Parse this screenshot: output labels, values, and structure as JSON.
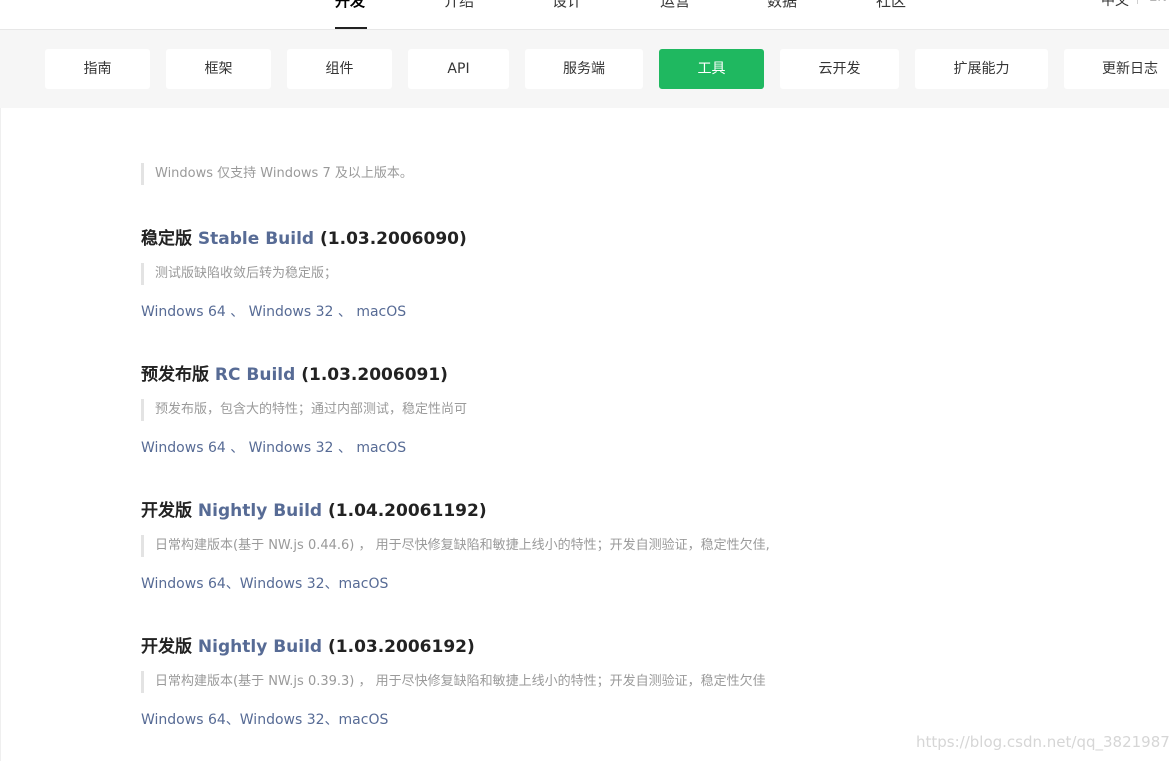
{
  "topnav": {
    "items": [
      {
        "label": "开发",
        "active": true
      },
      {
        "label": "介绍",
        "active": false
      },
      {
        "label": "设计",
        "active": false
      },
      {
        "label": "运营",
        "active": false
      },
      {
        "label": "数据",
        "active": false
      },
      {
        "label": "社区",
        "active": false
      }
    ],
    "lang_zh": "中文",
    "lang_en": "EN"
  },
  "tabs": [
    {
      "label": "指南",
      "active": false
    },
    {
      "label": "框架",
      "active": false
    },
    {
      "label": "组件",
      "active": false
    },
    {
      "label": "API",
      "active": false
    },
    {
      "label": "服务端",
      "active": false
    },
    {
      "label": "工具",
      "active": true
    },
    {
      "label": "云开发",
      "active": false
    },
    {
      "label": "扩展能力",
      "active": false
    },
    {
      "label": "更新日志",
      "active": false
    }
  ],
  "content": {
    "windows_note": "Windows 仅支持 Windows 7 及以上版本。",
    "builds": [
      {
        "prefix": "稳定版 ",
        "name": "Stable Build",
        "version": " (1.03.2006090)",
        "note": "测试版缺陷收敛后转为稳定版；",
        "links": [
          "Windows 64",
          "Windows 32",
          "macOS"
        ],
        "separator": " 、 "
      },
      {
        "prefix": "预发布版 ",
        "name": "RC Build",
        "version": " (1.03.2006091)",
        "note": "预发布版，包含大的特性；通过内部测试，稳定性尚可",
        "links": [
          "Windows 64",
          "Windows 32",
          "macOS"
        ],
        "separator": " 、 "
      },
      {
        "prefix": "开发版 ",
        "name": "Nightly Build",
        "version": " (1.04.20061192)",
        "note": "日常构建版本(基于 NW.js 0.44.6) ， 用于尽快修复缺陷和敏捷上线小的特性；开发自测验证，稳定性欠佳,",
        "links": [
          "Windows 64",
          "Windows 32",
          "macOS"
        ],
        "separator": "、"
      },
      {
        "prefix": "开发版 ",
        "name": "Nightly Build",
        "version": " (1.03.2006192)",
        "note": "日常构建版本(基于 NW.js 0.39.3) ， 用于尽快修复缺陷和敏捷上线小的特性；开发自测验证，稳定性欠佳",
        "links": [
          "Windows 64",
          "Windows 32",
          "macOS"
        ],
        "separator": "、"
      }
    ]
  },
  "watermark": "https://blog.csdn.net/qq_38219875",
  "colors": {
    "accent": "#1fb860",
    "link": "#576b95",
    "tabbar_bg": "#f6f6f6",
    "note_text": "#9a9a9a"
  }
}
